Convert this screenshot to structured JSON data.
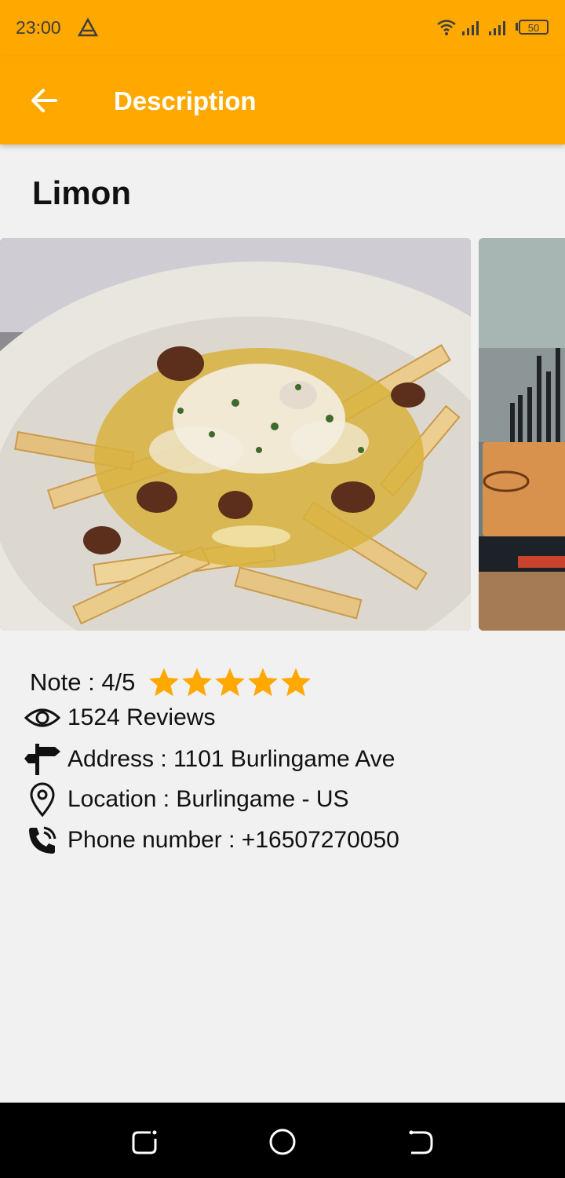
{
  "status_bar": {
    "time": "23:00",
    "battery": "50",
    "icons": [
      "alert-triangle-icon",
      "wifi-icon",
      "signal-icon",
      "signal-icon",
      "battery-icon"
    ]
  },
  "app_bar": {
    "title": "Description",
    "back_icon": "arrow-left-icon"
  },
  "place": {
    "name": "Limon"
  },
  "rating": {
    "label": "Note : 4/5",
    "stars": 5,
    "star_color": "#ffa800"
  },
  "details": {
    "reviews": "1524 Reviews",
    "address": "Address : 1101 Burlingame Ave",
    "location": "Location : Burlingame - US",
    "phone": "Phone number : +16507270050"
  },
  "colors": {
    "accent": "#ffa800",
    "background": "#f1f1f1",
    "text": "#111111"
  }
}
